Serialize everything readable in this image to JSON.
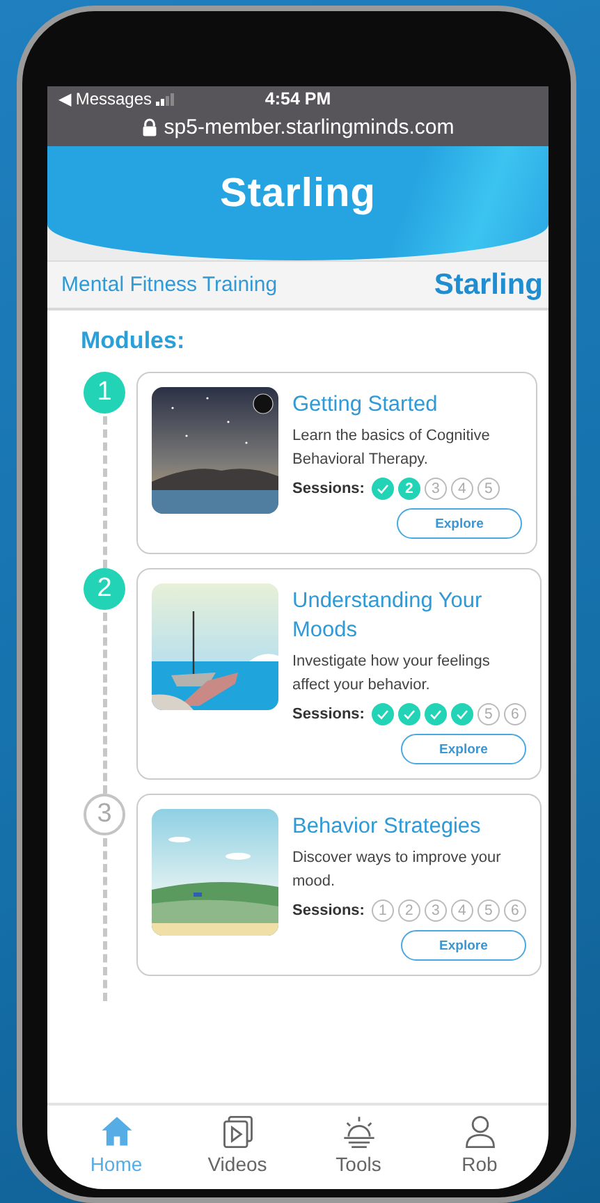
{
  "status_bar": {
    "back": "◀ Messages",
    "time": "4:54 PM",
    "url": "sp5-member.starlingminds.com"
  },
  "header": {
    "logo": "Starling"
  },
  "subheader": {
    "title": "Mental Fitness Training",
    "logo": "Starling"
  },
  "modules_title": "Modules:",
  "modules": [
    {
      "number": "1",
      "active": true,
      "image": {
        "kind": "night"
      },
      "title": "Getting Started",
      "description": "Learn the basics of Cognitive Behavioral Therapy.",
      "sessions_label": "Sessions:",
      "sessions": [
        {
          "kind": "done"
        },
        {
          "label": "2",
          "kind": "current"
        },
        {
          "label": "3",
          "kind": "locked"
        },
        {
          "label": "4",
          "kind": "locked"
        },
        {
          "label": "5",
          "kind": "locked"
        }
      ],
      "button": "Explore"
    },
    {
      "number": "2",
      "active": true,
      "image": {
        "kind": "sea"
      },
      "title": "Understanding Your Moods",
      "description": "Investigate how your feelings affect your behavior.",
      "sessions_label": "Sessions:",
      "sessions": [
        {
          "kind": "done"
        },
        {
          "kind": "done"
        },
        {
          "kind": "done"
        },
        {
          "kind": "done"
        },
        {
          "label": "5",
          "kind": "locked"
        },
        {
          "label": "6",
          "kind": "locked"
        }
      ],
      "button": "Explore"
    },
    {
      "number": "3",
      "active": false,
      "image": {
        "kind": "meadow"
      },
      "title": "Behavior Strategies",
      "description": "Discover ways to improve your mood.",
      "sessions_label": "Sessions:",
      "sessions": [
        {
          "label": "1",
          "kind": "locked"
        },
        {
          "label": "2",
          "kind": "locked"
        },
        {
          "label": "3",
          "kind": "locked"
        },
        {
          "label": "4",
          "kind": "locked"
        },
        {
          "label": "5",
          "kind": "locked"
        },
        {
          "label": "6",
          "kind": "locked"
        }
      ],
      "button": "Explore"
    }
  ],
  "tabs": [
    {
      "kind": "home",
      "label": "Home",
      "selected": true
    },
    {
      "kind": "videos",
      "label": "Videos",
      "selected": false
    },
    {
      "kind": "tools",
      "label": "Tools",
      "selected": false
    },
    {
      "kind": "profile",
      "label": "Rob",
      "selected": false
    }
  ]
}
